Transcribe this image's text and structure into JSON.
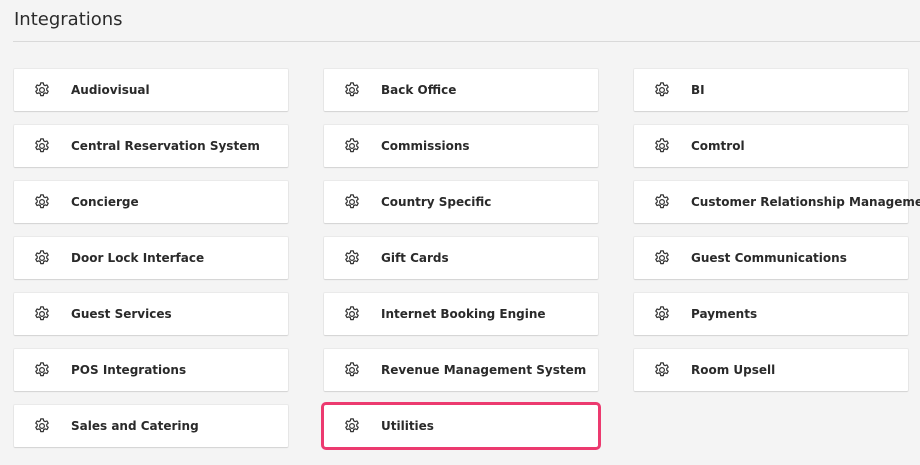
{
  "header": {
    "title": "Integrations"
  },
  "accent": "#ec3a6f",
  "items": [
    {
      "label": "Audiovisual",
      "icon": "gear-icon"
    },
    {
      "label": "Back Office",
      "icon": "gear-icon"
    },
    {
      "label": "BI",
      "icon": "gear-icon"
    },
    {
      "label": "Central Reservation System",
      "icon": "gear-icon"
    },
    {
      "label": "Commissions",
      "icon": "gear-icon"
    },
    {
      "label": "Comtrol",
      "icon": "gear-icon"
    },
    {
      "label": "Concierge",
      "icon": "gear-icon"
    },
    {
      "label": "Country Specific",
      "icon": "gear-icon"
    },
    {
      "label": "Customer Relationship Management",
      "icon": "gear-icon"
    },
    {
      "label": "Door Lock Interface",
      "icon": "gear-icon"
    },
    {
      "label": "Gift Cards",
      "icon": "gear-icon"
    },
    {
      "label": "Guest Communications",
      "icon": "gear-icon"
    },
    {
      "label": "Guest Services",
      "icon": "gear-icon"
    },
    {
      "label": "Internet Booking Engine",
      "icon": "gear-icon"
    },
    {
      "label": "Payments",
      "icon": "gear-icon"
    },
    {
      "label": "POS Integrations",
      "icon": "gear-icon"
    },
    {
      "label": "Revenue Management System",
      "icon": "gear-icon"
    },
    {
      "label": "Room Upsell",
      "icon": "gear-icon"
    },
    {
      "label": "Sales and Catering",
      "icon": "gear-icon"
    },
    {
      "label": "Utilities",
      "icon": "gear-icon",
      "selected": true
    }
  ]
}
